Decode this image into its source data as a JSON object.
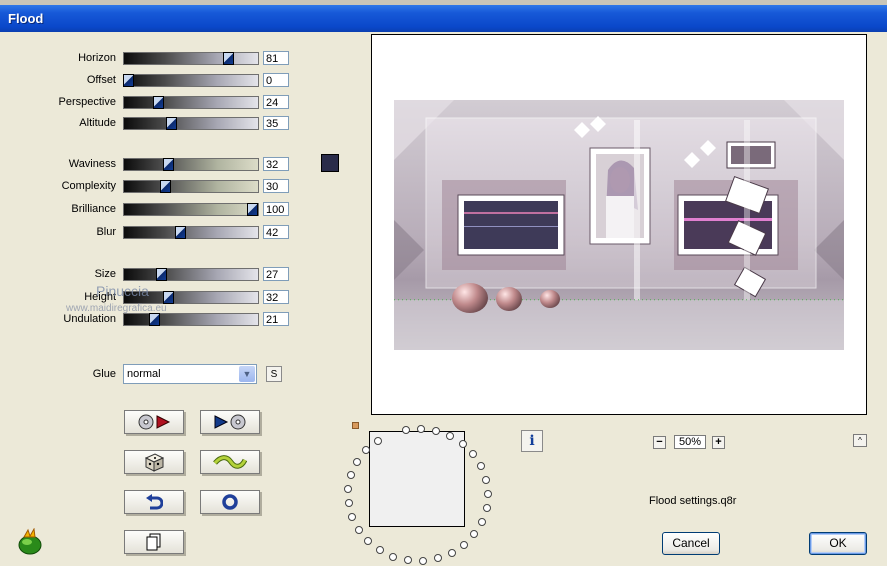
{
  "window": {
    "title": "Flood"
  },
  "sliders": [
    {
      "key": "horizon",
      "label": "Horizon",
      "value": "81",
      "fraction": 0.81
    },
    {
      "key": "offset",
      "label": "Offset",
      "value": "0",
      "fraction": 0.0
    },
    {
      "key": "perspective",
      "label": "Perspective",
      "value": "24",
      "fraction": 0.24
    },
    {
      "key": "altitude",
      "label": "Altitude",
      "value": "35",
      "fraction": 0.35
    },
    {
      "key": "waviness",
      "label": "Waviness",
      "value": "32",
      "fraction": 0.32
    },
    {
      "key": "complexity",
      "label": "Complexity",
      "value": "30",
      "fraction": 0.3
    },
    {
      "key": "brilliance",
      "label": "Brilliance",
      "value": "100",
      "fraction": 1.0
    },
    {
      "key": "blur",
      "label": "Blur",
      "value": "42",
      "fraction": 0.42
    },
    {
      "key": "size",
      "label": "Size",
      "value": "27",
      "fraction": 0.27
    },
    {
      "key": "height",
      "label": "Height",
      "value": "32",
      "fraction": 0.32
    },
    {
      "key": "undulation",
      "label": "Undulation",
      "value": "21",
      "fraction": 0.21
    }
  ],
  "color_swatch": "#2a2c4a",
  "watermark": {
    "name": "Pinuccia",
    "site": "www.maidiregrafica.eu"
  },
  "glue": {
    "label": "Glue",
    "value": "normal",
    "s_button": "S"
  },
  "buttons": [
    {
      "name": "load-preset-button",
      "icon": "disc-play-icon"
    },
    {
      "name": "save-preset-button",
      "icon": "play-disc-icon"
    },
    {
      "name": "randomize-button",
      "icon": "dice-icon"
    },
    {
      "name": "wave-button",
      "icon": "wave-icon"
    },
    {
      "name": "undo-button",
      "icon": "undo-arrow-icon"
    },
    {
      "name": "reset-button",
      "icon": "ring-icon"
    },
    {
      "name": "copy-button",
      "icon": "page-icon"
    }
  ],
  "info_button": "i",
  "zoom": {
    "value": "50%",
    "minus": "−",
    "plus": "+"
  },
  "collapse_button": "^",
  "settings_file": "Flood settings.q8r",
  "dialog": {
    "cancel": "Cancel",
    "ok": "OK"
  }
}
